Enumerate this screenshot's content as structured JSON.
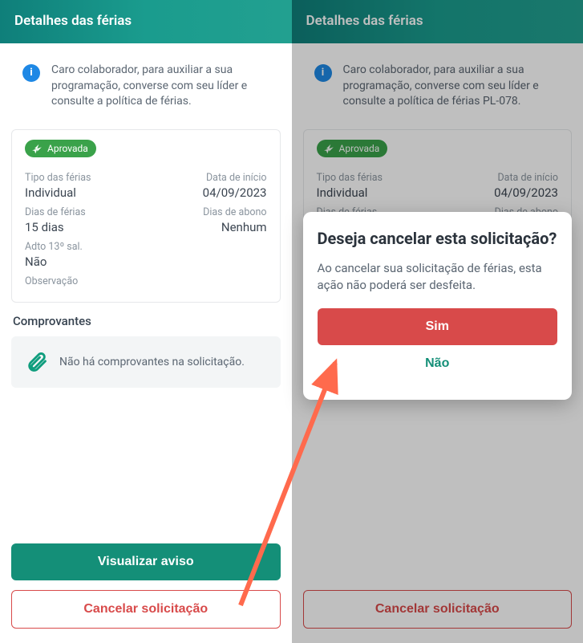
{
  "left": {
    "header_title": "Detalhes das férias",
    "info_text": "Caro colaborador, para auxiliar a sua programação, converse com seu líder e consulte a política de férias.",
    "badge": "Aprovada",
    "fields": {
      "type_lbl": "Tipo das férias",
      "type_val": "Individual",
      "start_lbl": "Data de início",
      "start_val": "04/09/2023",
      "days_lbl": "Dias de férias",
      "days_val": "15 dias",
      "abono_lbl": "Dias de abono",
      "abono_val": "Nenhum",
      "adto_lbl": "Adto 13º sal.",
      "adto_val": "Não",
      "obs_lbl": "Observação"
    },
    "section_receipts": "Comprovantes",
    "receipts_empty": "Não há comprovantes na solicitação.",
    "btn_view": "Visualizar aviso",
    "btn_cancel": "Cancelar solicitação"
  },
  "right": {
    "header_title": "Detalhes das férias",
    "info_text": "Caro colaborador, para auxiliar a sua programação, converse com seu líder e consulte a política de férias PL-078.",
    "badge": "Aprovada",
    "fields": {
      "type_lbl": "Tipo das férias",
      "type_val": "Individual",
      "start_lbl": "Data de início",
      "start_val": "04/09/2023",
      "days_lbl": "Dias de férias",
      "abono_lbl": "Dias de abono"
    },
    "btn_cancel": "Cancelar solicitação",
    "modal": {
      "title": "Deseja cancelar esta solicitação?",
      "body": "Ao cancelar sua solicitação de férias, esta ação não poderá ser desfeita.",
      "yes": "Sim",
      "no": "Não"
    }
  }
}
